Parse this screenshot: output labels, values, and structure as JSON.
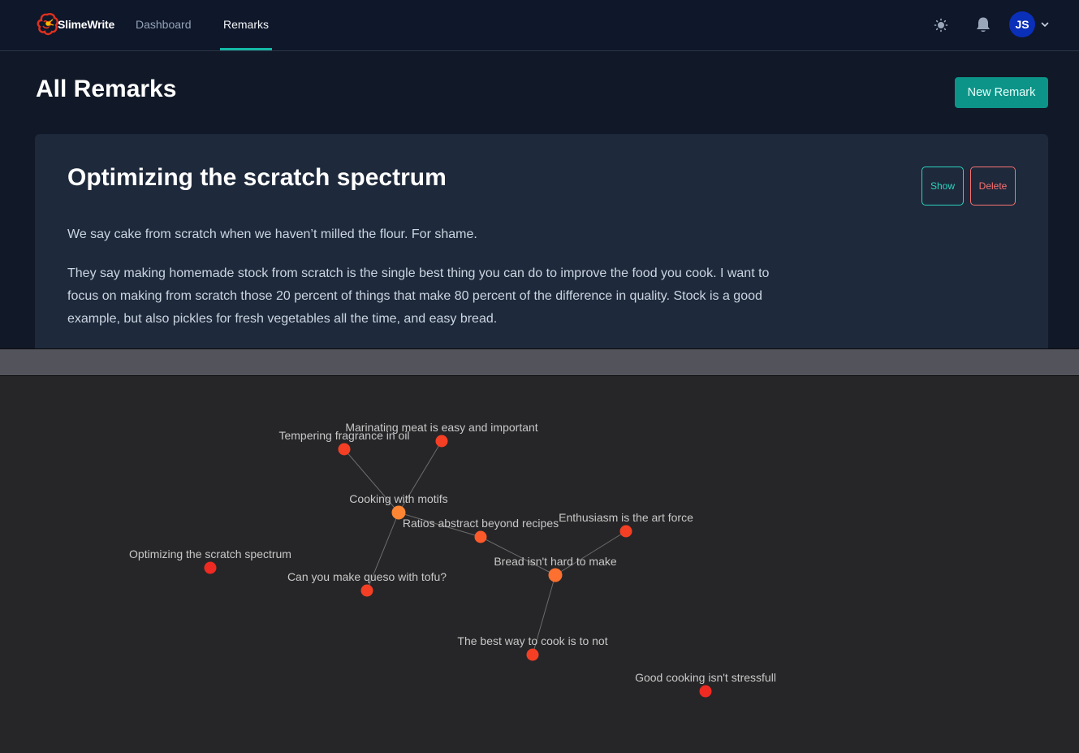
{
  "navbar": {
    "brand": "SlimeWrite",
    "links": [
      {
        "label": "Dashboard",
        "active": false
      },
      {
        "label": "Remarks",
        "active": true
      }
    ],
    "icons": {
      "theme": "sun-icon",
      "notifications": "bell-icon",
      "caret": "chevron-down-icon"
    },
    "user_initials": "JS"
  },
  "page": {
    "title": "All Remarks",
    "new_button": "New Remark"
  },
  "remark": {
    "title": "Optimizing the scratch spectrum",
    "show_label": "Show",
    "delete_label": "Delete",
    "paragraphs": [
      "We say cake from scratch when we haven’t milled the flour. For shame.",
      "They say making homemade stock from scratch is the single best thing you can do to improve the food you cook. I want to focus on making from scratch those 20 percent of things that make 80 percent of the difference in quality. Stock is a good example, but also pickles for fresh vegetables all the time, and easy bread."
    ]
  },
  "colors": {
    "accent": "#14b8a6",
    "primary_button": "#0d9488",
    "danger": "#f87171",
    "node_hub": "#fd8533",
    "node_mid": "#fc5a2a",
    "node_leaf": "#f43f25",
    "node_isolated": "#ee2a22"
  },
  "graph": {
    "nodes": [
      {
        "id": "tempering",
        "label": "Tempering fragrance in oil",
        "color": "#f43f25"
      },
      {
        "id": "marinating",
        "label": "Marinating meat is easy and important",
        "color": "#f43f25"
      },
      {
        "id": "motifs",
        "label": "Cooking with motifs",
        "color": "#fd8533"
      },
      {
        "id": "ratios",
        "label": "Ratios abstract beyond recipes",
        "color": "#fc5a2a"
      },
      {
        "id": "enthusiasm",
        "label": "Enthusiasm is the art force",
        "color": "#f43f25"
      },
      {
        "id": "scratch",
        "label": "Optimizing the scratch spectrum",
        "color": "#ee2a22"
      },
      {
        "id": "bread",
        "label": "Bread isn't hard to make",
        "color": "#fd7030"
      },
      {
        "id": "queso",
        "label": "Can you make queso with tofu?",
        "color": "#f43f25"
      },
      {
        "id": "bestway",
        "label": "The best way to cook is to not",
        "color": "#f43f25"
      },
      {
        "id": "good",
        "label": "Good cooking isn't stressfull",
        "color": "#ee2a22"
      }
    ],
    "links": [
      [
        "tempering",
        "motifs"
      ],
      [
        "marinating",
        "motifs"
      ],
      [
        "motifs",
        "ratios"
      ],
      [
        "motifs",
        "queso"
      ],
      [
        "ratios",
        "bread"
      ],
      [
        "enthusiasm",
        "bread"
      ],
      [
        "bread",
        "bestway"
      ]
    ]
  }
}
